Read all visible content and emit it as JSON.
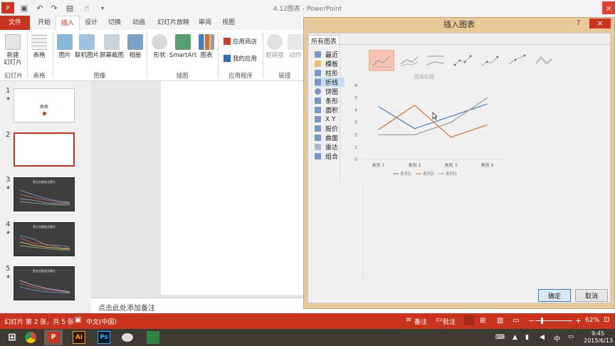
{
  "window": {
    "title": "4.12图表 - PowerPoint"
  },
  "tabs": [
    "文件",
    "开始",
    "插入",
    "设计",
    "切换",
    "动画",
    "幻灯片放映",
    "审阅",
    "视图"
  ],
  "ribbon": {
    "buttons": [
      "新建\n幻灯片",
      "表格",
      "图片",
      "联机图片",
      "屏幕截图",
      "相册",
      "形状",
      "SmartArt",
      "图表",
      "应用商店",
      "我的应用",
      "超链接",
      "动作"
    ],
    "groups": [
      "幻灯片",
      "表格",
      "图像",
      "插图",
      "应用程序",
      "链接"
    ]
  },
  "thumbnails": [
    {
      "num": "1",
      "star": "★",
      "title": "图表"
    },
    {
      "num": "2",
      "star": ""
    },
    {
      "num": "3",
      "star": "★",
      "title": "营业总额变化情况"
    },
    {
      "num": "4",
      "star": "★",
      "title": "营业总额变化情况"
    },
    {
      "num": "5",
      "star": "★",
      "title": "营业总额变化情况"
    }
  ],
  "notes_placeholder": "点击此处添加备注",
  "status": {
    "slide_info": "幻灯片 第 2 张，共 5 张",
    "language": "中文(中国)",
    "notes": "备注",
    "comments": "批注",
    "zoom_minus": "−",
    "zoom_plus": "+",
    "zoom": "62%"
  },
  "taskbar": {
    "time": "9:45",
    "date": "2015/6/13",
    "apps": [
      "Ai",
      "Ps"
    ]
  },
  "dialog": {
    "title": "插入图表",
    "help": "?",
    "close": "×",
    "tab": "所有图表",
    "nav": [
      "最近",
      "模板",
      "柱形",
      "折线",
      "饼图",
      "条形",
      "面积",
      "X Y",
      "股价",
      "曲面",
      "雷达",
      "组合"
    ],
    "selected_nav": "折线",
    "chart_types": [
      "折线图",
      "堆积折线图",
      "百分比堆积折线图",
      "带数据标记的折线图",
      "带数据标记的堆积折线图",
      "带数据标记的百分比堆积折线图",
      "三维折线图"
    ],
    "ok": "确定",
    "cancel": "取消"
  },
  "chart_data": {
    "type": "line",
    "title": "图表标题",
    "categories": [
      "类别 1",
      "类别 2",
      "类别 3",
      "类别 4"
    ],
    "series": [
      {
        "name": "系列1",
        "values": [
          4.3,
          2.5,
          3.5,
          4.5
        ],
        "color": "#4a7fbb"
      },
      {
        "name": "系列2",
        "values": [
          2.4,
          4.4,
          1.8,
          2.8
        ],
        "color": "#d2722f"
      },
      {
        "name": "系列3",
        "values": [
          2,
          2,
          3,
          5
        ],
        "color": "#9a9a9a"
      }
    ],
    "yticks": [
      "0",
      "1",
      "2",
      "3",
      "4",
      "5",
      "6"
    ],
    "ylim": [
      0,
      6
    ],
    "legend_position": "bottom",
    "grid": true,
    "legend_labels": [
      "系列1",
      "系列2",
      "系列3"
    ]
  }
}
